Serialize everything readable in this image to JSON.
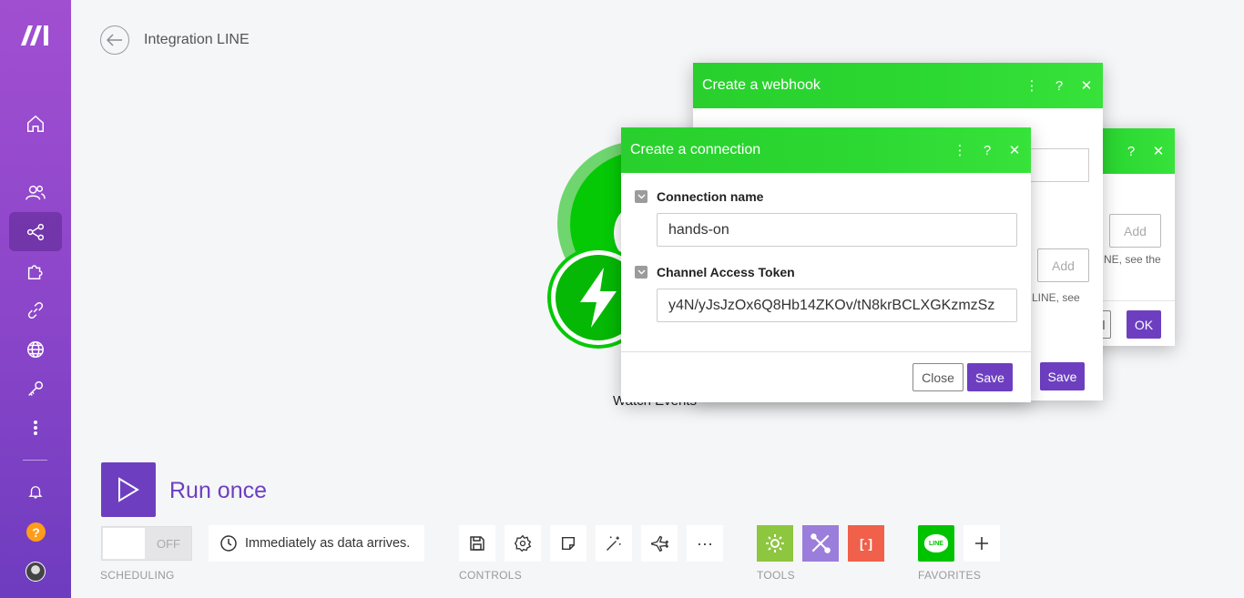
{
  "app": {
    "brand_logo": "make-logo",
    "accent_color": "#6d3fc0",
    "success_color": "#2cd832"
  },
  "header": {
    "back_icon": "arrow-left-icon",
    "title": "Integration LINE"
  },
  "sidebar": {
    "items": [
      {
        "name": "home",
        "icon": "home-icon"
      },
      {
        "name": "team",
        "icon": "users-icon"
      },
      {
        "name": "scenarios",
        "icon": "share-icon",
        "active": true
      },
      {
        "name": "templates",
        "icon": "puzzle-icon"
      },
      {
        "name": "connections",
        "icon": "link-icon"
      },
      {
        "name": "webhooks",
        "icon": "globe-icon"
      },
      {
        "name": "keys",
        "icon": "key-icon"
      },
      {
        "name": "more",
        "icon": "more-vertical-icon"
      }
    ],
    "notifications_icon": "bell-icon",
    "help_label": "?",
    "avatar": "user-avatar"
  },
  "canvas": {
    "module_label": "Watch Events"
  },
  "dialog_back": {
    "add_label_1": "Add",
    "hint_text": "NE, see the",
    "cancel_label": "el",
    "ok_label": "OK"
  },
  "dialog_webhook": {
    "title": "Create a webhook",
    "add_label": "Add",
    "hint_text": "LINE, see",
    "save_label": "Save"
  },
  "dialog_connection": {
    "title": "Create a connection",
    "fields": [
      {
        "label": "Connection name",
        "value": "hands-on"
      },
      {
        "label": "Channel Access Token",
        "value": "y4N/yJsJzOx6Q8Hb14ZKOv/tN8krBCLXGKzmzSz"
      }
    ],
    "close_label": "Close",
    "save_label": "Save"
  },
  "toolbar": {
    "run_label": "Run once",
    "toggle_label": "OFF",
    "schedule_text": "Immediately as data arrives.",
    "scheduling_label": "SCHEDULING",
    "controls_label": "CONTROLS",
    "tools_label": "TOOLS",
    "favorites_label": "FAVORITES",
    "more_label": "···",
    "favorite_app_label": "LINE"
  }
}
